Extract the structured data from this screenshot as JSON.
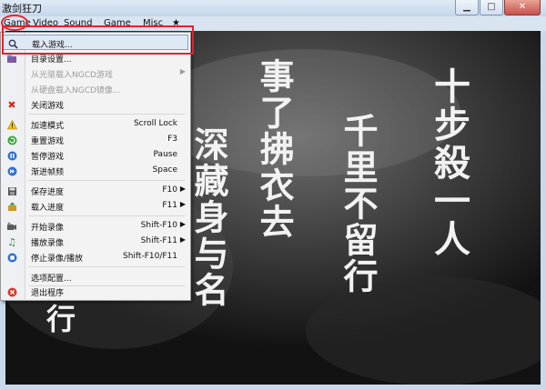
{
  "window": {
    "title": "激剑狂刀"
  },
  "menubar": {
    "items": [
      "Game",
      "Video",
      "Sound",
      "Game",
      "Misc",
      "★"
    ]
  },
  "menu": {
    "items": [
      {
        "label": "载入游戏...",
        "shortcut": "",
        "icon": "magnifier-icon",
        "selected": true
      },
      {
        "label": "目录设置...",
        "shortcut": "",
        "icon": "folder-icon"
      },
      {
        "label": "从光驱载入NGCD游戏",
        "shortcut": "",
        "icon": "",
        "disabled": true,
        "submenu": true
      },
      {
        "label": "从硬盘载入NGCD镜像...",
        "shortcut": "",
        "icon": "",
        "disabled": true
      },
      {
        "label": "关闭游戏",
        "shortcut": "",
        "icon": "close-x-icon"
      },
      {
        "label": "加速模式",
        "shortcut": "Scroll Lock",
        "icon": "warning-icon"
      },
      {
        "label": "重置游戏",
        "shortcut": "F3",
        "icon": "reset-icon"
      },
      {
        "label": "暂停游戏",
        "shortcut": "Pause",
        "icon": "pause-icon"
      },
      {
        "label": "渐进帧频",
        "shortcut": "Space",
        "icon": "fast-forward-icon"
      },
      {
        "label": "保存进度",
        "shortcut": "F10",
        "icon": "save-icon",
        "submenu": true
      },
      {
        "label": "载入进度",
        "shortcut": "F11",
        "icon": "load-icon",
        "submenu": true
      },
      {
        "label": "开始录像",
        "shortcut": "Shift-F10",
        "icon": "record-icon",
        "submenu": true
      },
      {
        "label": "播放录像",
        "shortcut": "Shift-F11",
        "icon": "music-play-icon",
        "submenu": true
      },
      {
        "label": "停止录像/播放",
        "shortcut": "Shift-F10/F11",
        "icon": "stop-icon"
      },
      {
        "label": "选项配置...",
        "shortcut": "",
        "icon": ""
      },
      {
        "label": "退出程序",
        "shortcut": "",
        "icon": "exit-icon"
      }
    ]
  },
  "game_screen": {
    "text_col_1": "十步殺一人",
    "text_col_2": "千里不留行",
    "text_col_3": "事了拂衣去",
    "text_col_4": "深藏身与名",
    "text_col_5": "行"
  },
  "colors": {
    "highlight": "#e8222a"
  }
}
